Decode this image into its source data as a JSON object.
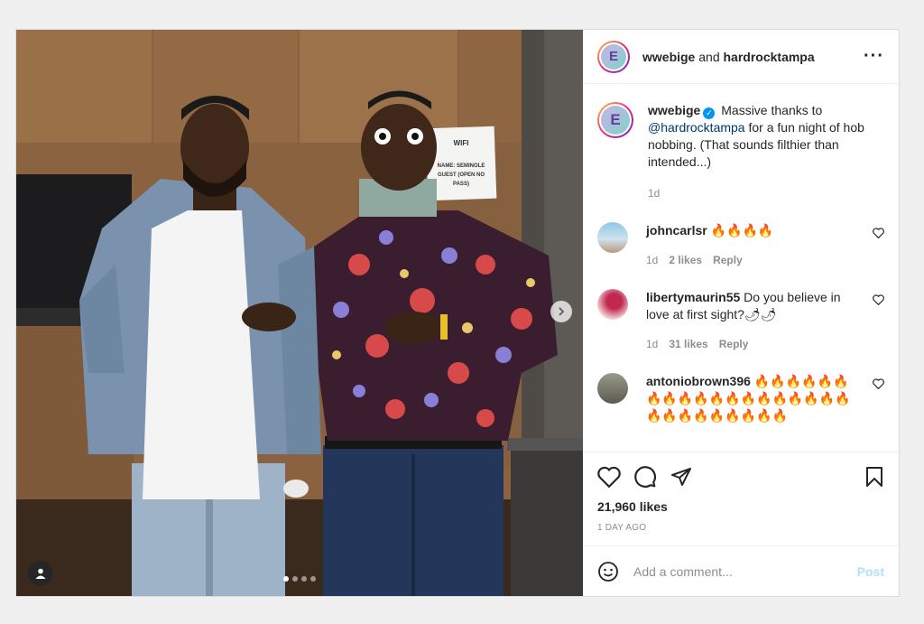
{
  "header": {
    "user1": "wwebige",
    "and_text": "and",
    "user2": "hardrocktampa"
  },
  "photo": {
    "sign_lines": [
      "WIFI",
      "NAME: SEMINOLE",
      "GUEST (OPEN NO",
      "PASS)"
    ]
  },
  "caption": {
    "username": "wwebige",
    "text_before": "Massive thanks to",
    "mention": "@hardrocktampa",
    "text_after": "for a fun night of hob nobbing. (That sounds filthier than intended...)",
    "time": "1d"
  },
  "comments": [
    {
      "username": "johncarlsr",
      "text": "🔥🔥🔥🔥",
      "time": "1d",
      "likes": "2 likes",
      "reply": "Reply"
    },
    {
      "username": "libertymaurin55",
      "text": "Do you believe in love at first sight?🌶🌶",
      "time": "1d",
      "likes": "31 likes",
      "reply": "Reply"
    },
    {
      "username": "antoniobrown396",
      "text": "🔥🔥🔥🔥🔥🔥🔥🔥🔥🔥🔥🔥🔥🔥🔥🔥🔥🔥🔥🔥🔥🔥🔥🔥🔥🔥🔥🔥"
    }
  ],
  "likes": "21,960 likes",
  "posted": "1 DAY AGO",
  "add_comment": {
    "placeholder": "Add a comment...",
    "post_label": "Post"
  },
  "colors": {
    "accent": "#0095f6",
    "post_disabled": "#b2dffc",
    "mention": "#00376b"
  }
}
